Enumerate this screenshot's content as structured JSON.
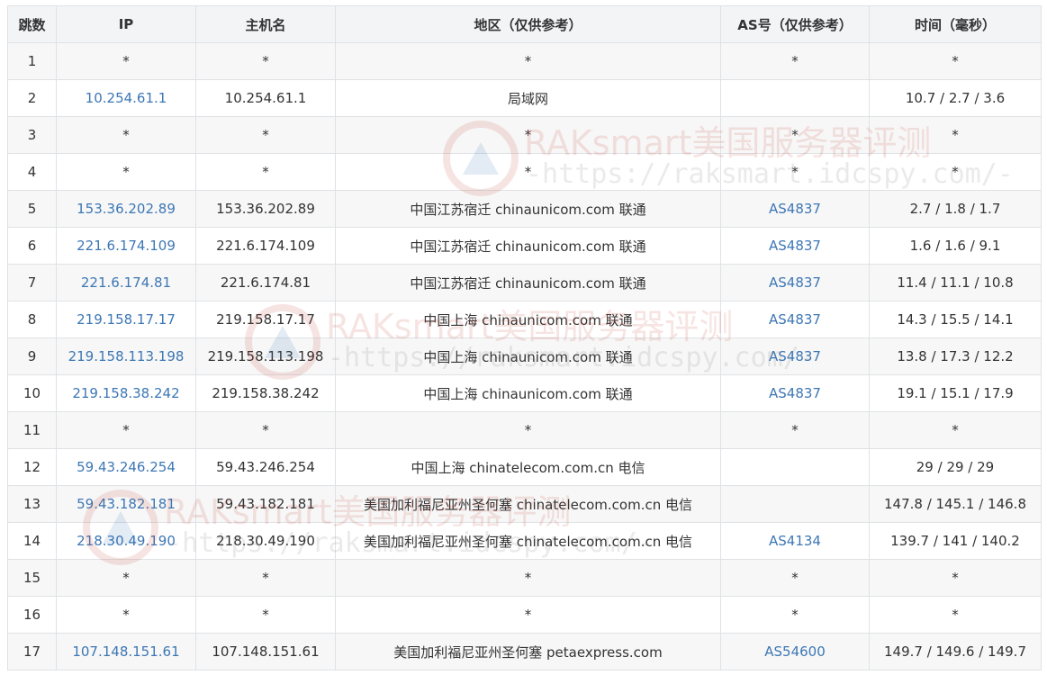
{
  "headers": [
    "跳数",
    "IP",
    "主机名",
    "地区（仅供参考）",
    "AS号（仅供参考）",
    "时间（毫秒）"
  ],
  "rows": [
    {
      "hop": "1",
      "ip": "*",
      "host": "*",
      "region": "*",
      "as": "*",
      "time": "*"
    },
    {
      "hop": "2",
      "ip": "10.254.61.1",
      "host": "10.254.61.1",
      "region": "局域网",
      "as": "",
      "time": "10.7 / 2.7 / 3.6"
    },
    {
      "hop": "3",
      "ip": "*",
      "host": "*",
      "region": "*",
      "as": "*",
      "time": "*"
    },
    {
      "hop": "4",
      "ip": "*",
      "host": "*",
      "region": "*",
      "as": "*",
      "time": "*"
    },
    {
      "hop": "5",
      "ip": "153.36.202.89",
      "host": "153.36.202.89",
      "region": "中国江苏宿迁 chinaunicom.com 联通",
      "as": "AS4837",
      "time": "2.7 / 1.8 / 1.7"
    },
    {
      "hop": "6",
      "ip": "221.6.174.109",
      "host": "221.6.174.109",
      "region": "中国江苏宿迁 chinaunicom.com 联通",
      "as": "AS4837",
      "time": "1.6 / 1.6 / 9.1"
    },
    {
      "hop": "7",
      "ip": "221.6.174.81",
      "host": "221.6.174.81",
      "region": "中国江苏宿迁 chinaunicom.com 联通",
      "as": "AS4837",
      "time": "11.4 / 11.1 / 10.8"
    },
    {
      "hop": "8",
      "ip": "219.158.17.17",
      "host": "219.158.17.17",
      "region": "中国上海 chinaunicom.com 联通",
      "as": "AS4837",
      "time": "14.3 / 15.5 / 14.1"
    },
    {
      "hop": "9",
      "ip": "219.158.113.198",
      "host": "219.158.113.198",
      "region": "中国上海 chinaunicom.com 联通",
      "as": "AS4837",
      "time": "13.8 / 17.3 / 12.2"
    },
    {
      "hop": "10",
      "ip": "219.158.38.242",
      "host": "219.158.38.242",
      "region": "中国上海 chinaunicom.com 联通",
      "as": "AS4837",
      "time": "19.1 / 15.1 / 17.9"
    },
    {
      "hop": "11",
      "ip": "*",
      "host": "*",
      "region": "*",
      "as": "*",
      "time": "*"
    },
    {
      "hop": "12",
      "ip": "59.43.246.254",
      "host": "59.43.246.254",
      "region": "中国上海 chinatelecom.com.cn 电信",
      "as": "",
      "time": "29 / 29 / 29"
    },
    {
      "hop": "13",
      "ip": "59.43.182.181",
      "host": "59.43.182.181",
      "region": "美国加利福尼亚州圣何塞 chinatelecom.com.cn 电信",
      "as": "",
      "time": "147.8 / 145.1 / 146.8"
    },
    {
      "hop": "14",
      "ip": "218.30.49.190",
      "host": "218.30.49.190",
      "region": "美国加利福尼亚州圣何塞 chinatelecom.com.cn 电信",
      "as": "AS4134",
      "time": "139.7 / 141 / 140.2"
    },
    {
      "hop": "15",
      "ip": "*",
      "host": "*",
      "region": "*",
      "as": "*",
      "time": "*"
    },
    {
      "hop": "16",
      "ip": "*",
      "host": "*",
      "region": "*",
      "as": "*",
      "time": "*"
    },
    {
      "hop": "17",
      "ip": "107.148.151.61",
      "host": "107.148.151.61",
      "region": "美国加利福尼亚州圣何塞 petaexpress.com",
      "as": "AS54600",
      "time": "149.7 / 149.6 / 149.7"
    }
  ],
  "watermark": {
    "title": "RAKsmart美国服务器评测",
    "url": "-https://raksmart.idcspy.com/-",
    "icon": "raksmart-logo-icon"
  },
  "colors": {
    "link": "#3d77b4",
    "header_bg": "#f3f4f6",
    "row_alt": "#f7f7f7",
    "border": "#dfe2e5"
  }
}
